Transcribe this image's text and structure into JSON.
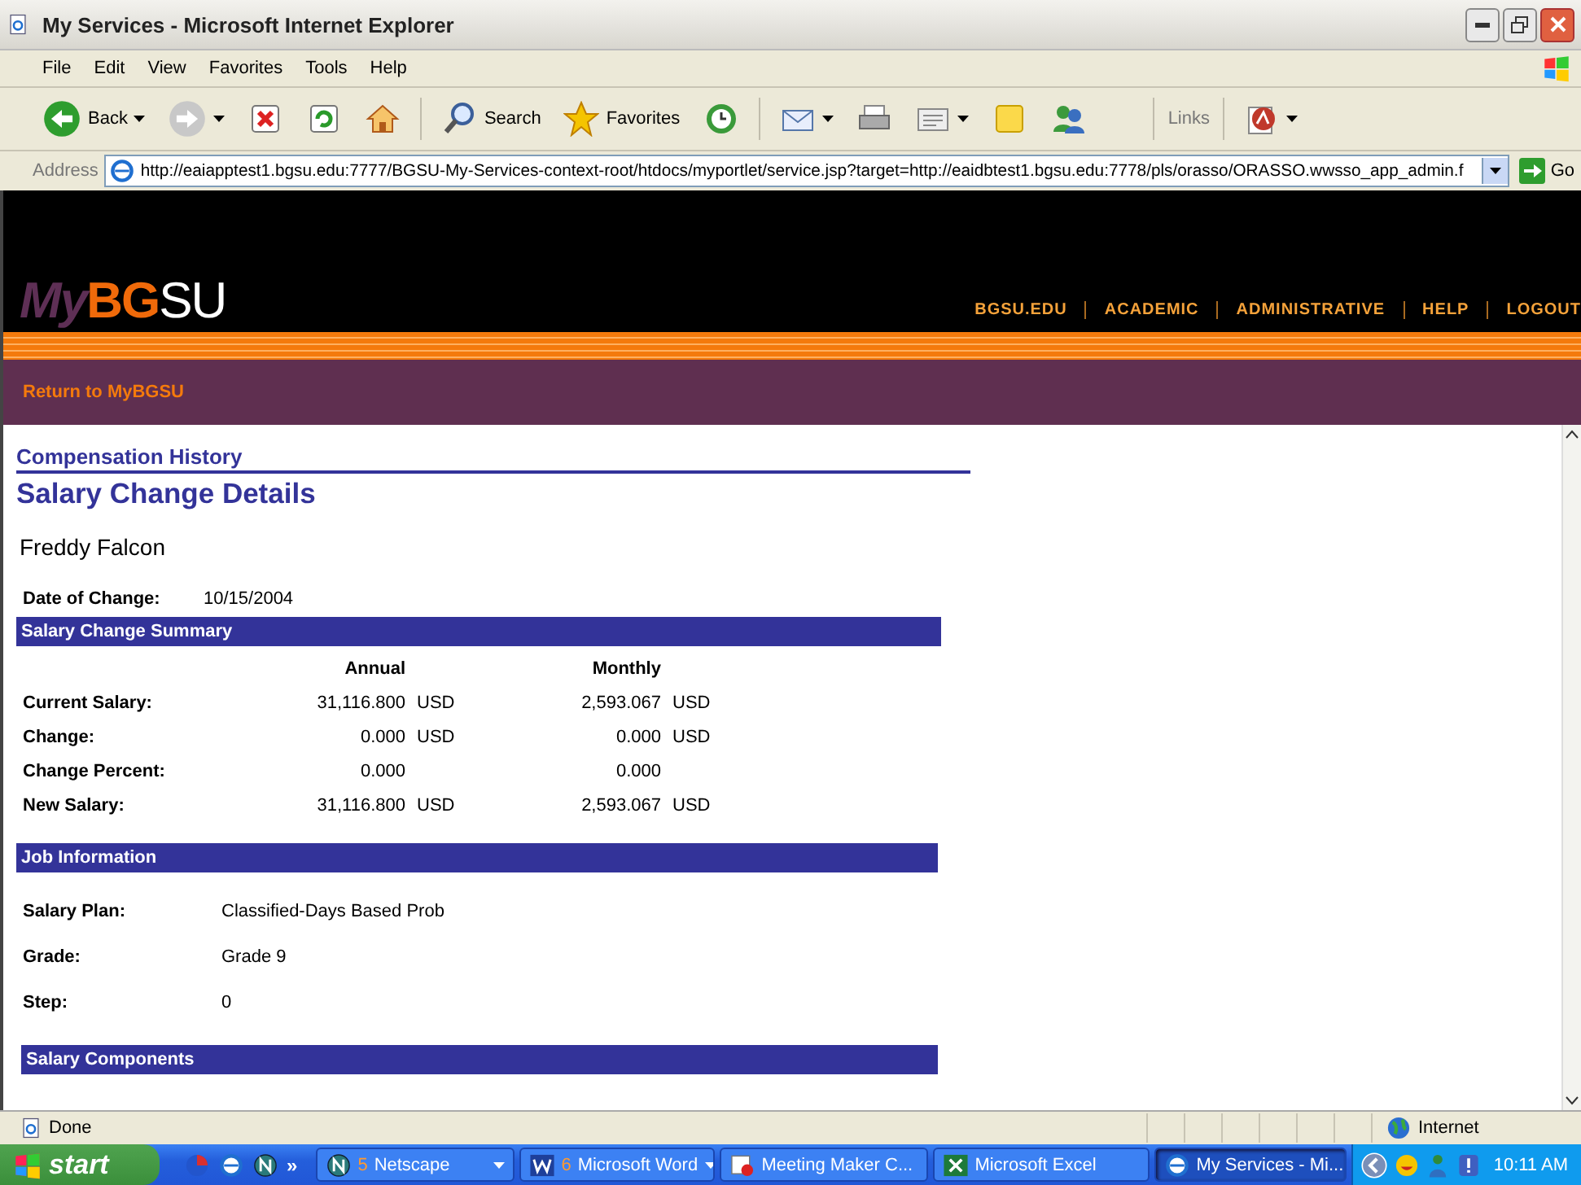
{
  "window": {
    "title": "My Services - Microsoft Internet Explorer"
  },
  "menu": [
    "File",
    "Edit",
    "View",
    "Favorites",
    "Tools",
    "Help"
  ],
  "toolbar": {
    "buttons": [
      {
        "kind": "back",
        "label": "Back",
        "dropdown": true
      },
      {
        "kind": "forward",
        "dropdown": true
      },
      {
        "kind": "stop"
      },
      {
        "kind": "refresh"
      },
      {
        "kind": "home"
      },
      {
        "kind": "search",
        "label": "Search"
      },
      {
        "kind": "favorites",
        "label": "Favorites"
      },
      {
        "kind": "history"
      },
      {
        "kind": "mail",
        "dropdown": true
      },
      {
        "kind": "print"
      },
      {
        "kind": "edit",
        "dropdown": true
      },
      {
        "kind": "note"
      },
      {
        "kind": "messenger"
      }
    ],
    "links": "Links",
    "extra": {
      "kind": "pdf",
      "dropdown": true
    }
  },
  "address": {
    "label": "Address",
    "url": "http://eaiapptest1.bgsu.edu:7777/BGSU-My-Services-context-root/htdocs/myportlet/service.jsp?target=http://eaidbtest1.bgsu.edu:7778/pls/orasso/ORASSO.wwsso_app_admin.f",
    "go": "Go"
  },
  "site": {
    "logo": {
      "my": "My",
      "bg": "BG",
      "su": "SU"
    },
    "nav": [
      "BGSU.EDU",
      "ACADEMIC",
      "ADMINISTRATIVE",
      "HELP",
      "LOGOUT"
    ],
    "return_link": "Return to MyBGSU"
  },
  "page": {
    "breadcrumb": "Compensation History",
    "title": "Salary Change Details",
    "employee": "Freddy Falcon",
    "date_label": "Date of Change:",
    "date": "10/15/2004",
    "summary": {
      "heading": "Salary Change Summary",
      "columns": [
        "Annual",
        "Monthly"
      ],
      "rows": [
        {
          "label": "Current Salary:",
          "annual": "31,116.800",
          "annual_unit": "USD",
          "monthly": "2,593.067",
          "monthly_unit": "USD"
        },
        {
          "label": "Change:",
          "annual": "0.000",
          "annual_unit": "USD",
          "monthly": "0.000",
          "monthly_unit": "USD"
        },
        {
          "label": "Change Percent:",
          "annual": "0.000",
          "monthly": "0.000"
        },
        {
          "label": "New Salary:",
          "annual": "31,116.800",
          "annual_unit": "USD",
          "monthly": "2,593.067",
          "monthly_unit": "USD"
        }
      ]
    },
    "job": {
      "heading": "Job Information",
      "fields": [
        {
          "label": "Salary Plan:",
          "value": "Classified-Days Based Prob"
        },
        {
          "label": "Grade:",
          "value": "Grade 9"
        },
        {
          "label": "Step:",
          "value": "0"
        }
      ]
    },
    "next_heading": "Salary Components"
  },
  "status_bar": {
    "text": "Done",
    "zone": "Internet"
  },
  "taskbar": {
    "start": "start",
    "quick_launch": [
      {
        "kind": "browser-red"
      },
      {
        "kind": "ie"
      },
      {
        "kind": "netscape"
      }
    ],
    "more": "»",
    "buttons": [
      {
        "kind": "netscape",
        "count": "5",
        "label": "Netscape",
        "dropdown": true,
        "selected": false
      },
      {
        "kind": "word",
        "count": "6",
        "label": "Microsoft Word",
        "dropdown": true,
        "selected": false
      },
      {
        "kind": "meeting",
        "label": "Meeting Maker C...",
        "selected": false
      },
      {
        "kind": "excel",
        "label": "Microsoft Excel",
        "selected": false
      },
      {
        "kind": "ie",
        "label": "My Services - Mi...",
        "selected": true
      }
    ],
    "clock": "10:11 AM"
  }
}
